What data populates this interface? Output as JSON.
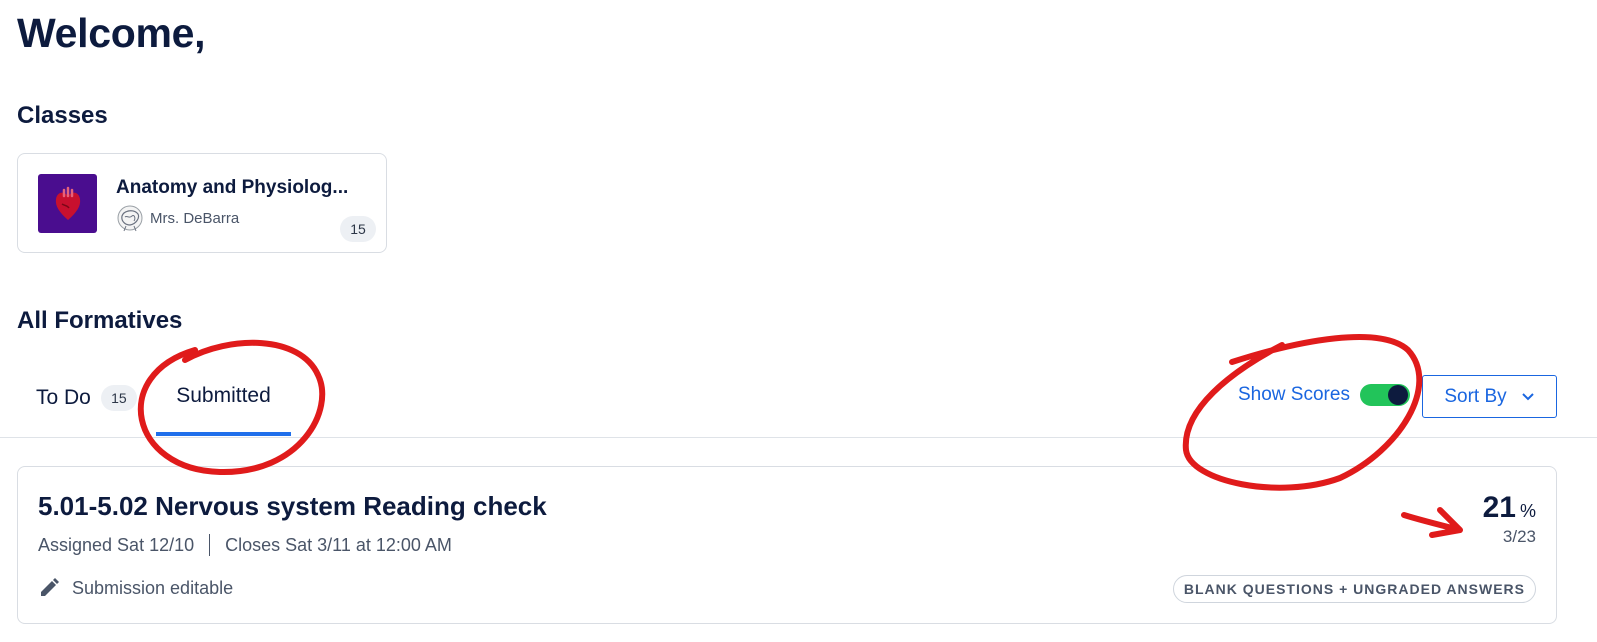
{
  "header": {
    "welcome": "Welcome,"
  },
  "classes": {
    "title": "Classes",
    "items": [
      {
        "name": "Anatomy and Physiolog...",
        "teacher": "Mrs. DeBarra",
        "count": "15"
      }
    ]
  },
  "formatives": {
    "title": "All Formatives",
    "tabs": [
      {
        "label": "To Do",
        "count": "15",
        "active": false
      },
      {
        "label": "Submitted",
        "active": true
      }
    ],
    "show_scores_label": "Show Scores",
    "show_scores_on": true,
    "sort_by_label": "Sort By",
    "items": [
      {
        "title": "5.01-5.02 Nervous system Reading check",
        "assigned": "Assigned Sat 12/10",
        "closes": "Closes Sat 3/11 at 12:00 AM",
        "submission_status": "Submission editable",
        "score_value": "21",
        "score_unit": "%",
        "score_fraction": "3/23",
        "score_tag": "BLANK QUESTIONS + UNGRADED ANSWERS"
      }
    ]
  },
  "colors": {
    "primary_text": "#0d1b3e",
    "accent_blue": "#1a66e0",
    "toggle_on": "#22c45a",
    "class_thumb": "#4a0d8f",
    "annotation_red": "#e01b1b"
  },
  "icons": {
    "class_thumb": "heart-icon",
    "teacher_avatar": "avatar-icon",
    "sort": "chevron-down-icon",
    "submission": "pencil-icon"
  }
}
